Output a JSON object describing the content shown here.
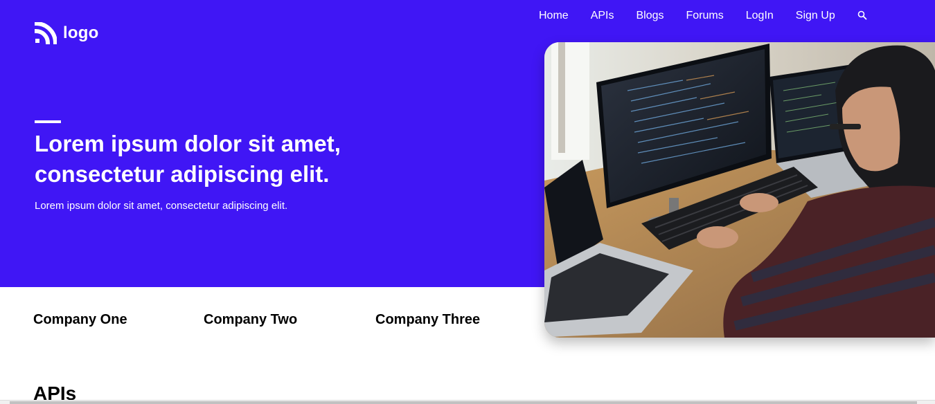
{
  "logo": {
    "text": "logo",
    "icon": "rss-icon"
  },
  "nav": {
    "items": [
      "Home",
      "APIs",
      "Blogs",
      "Forums",
      "LogIn",
      "Sign Up"
    ],
    "search_icon": "search-icon"
  },
  "hero": {
    "title": "Lorem ipsum dolor sit amet, consectetur adipiscing elit.",
    "subtitle": "Lorem ipsum dolor sit amet, consectetur adipiscing elit.",
    "image": "developer-at-computers-photo"
  },
  "companies": [
    "Company One",
    "Company Two",
    "Company Three"
  ],
  "section": {
    "title": "APIs"
  },
  "colors": {
    "brand": "#4016f5",
    "text_on_brand": "#ffffff",
    "text": "#000000"
  }
}
